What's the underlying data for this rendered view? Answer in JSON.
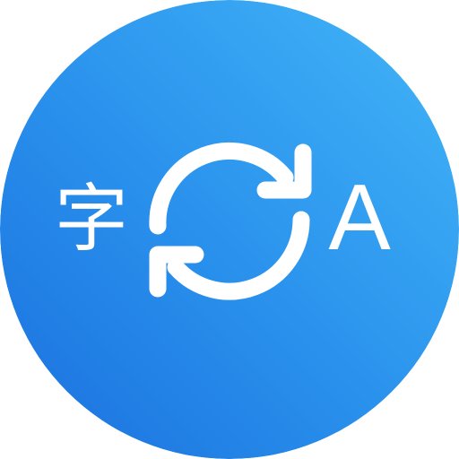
{
  "icon": {
    "source_glyph": "字",
    "target_glyph": "A",
    "center_icon": "swap-arrows-icon",
    "colors": {
      "gradient_top_right": "#43B6F8",
      "gradient_bottom_left": "#1A70DE",
      "foreground": "#FFFFFF"
    }
  }
}
